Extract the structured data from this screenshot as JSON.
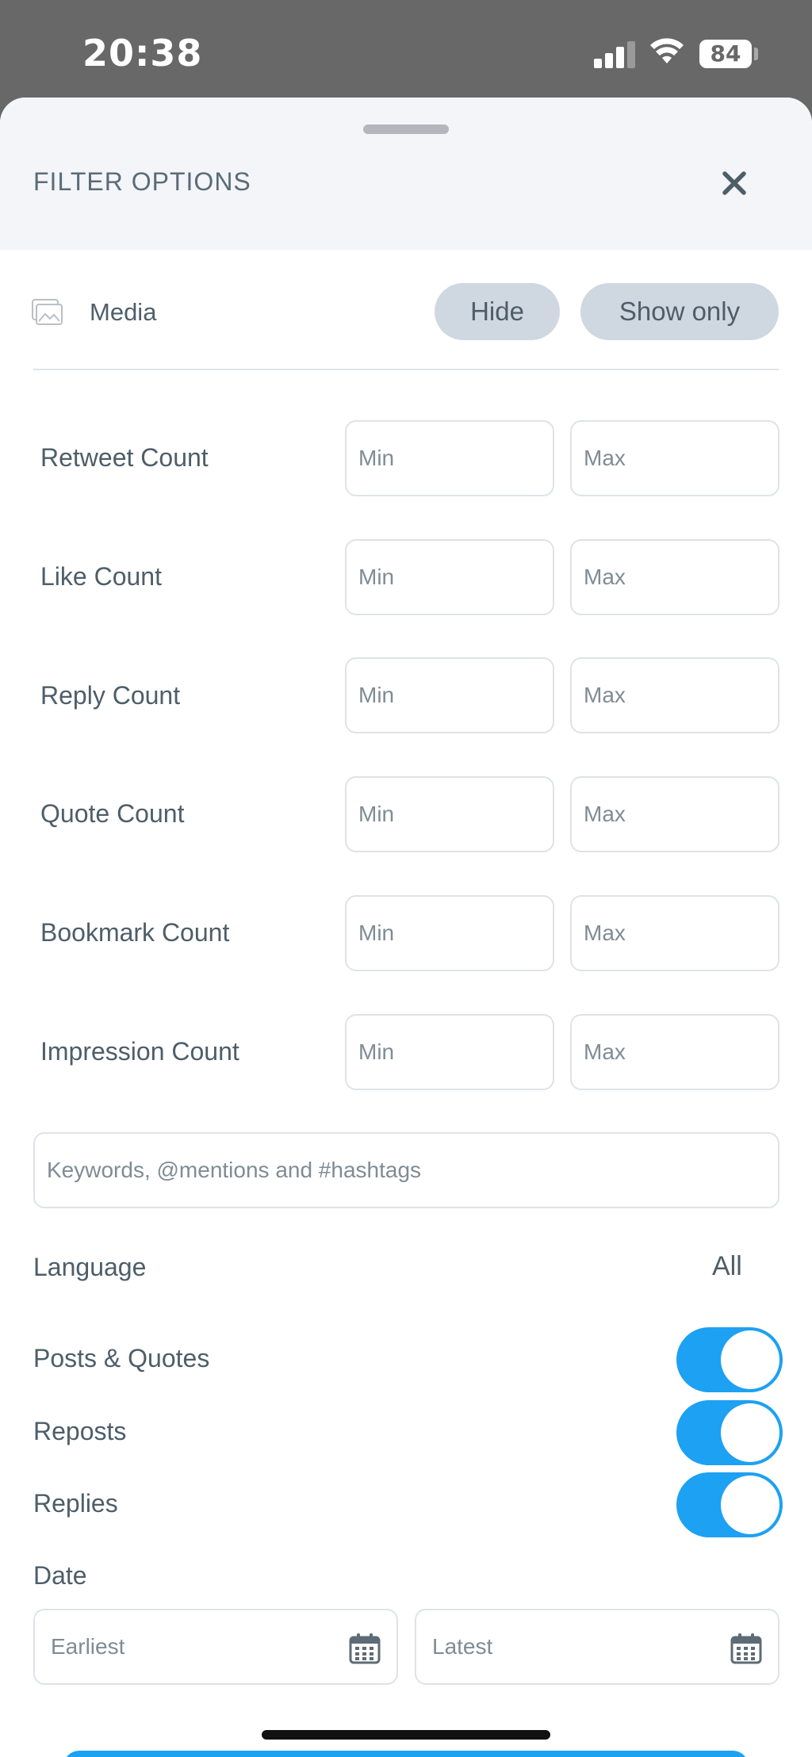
{
  "status_bar": {
    "time": "20:38",
    "battery": "84"
  },
  "header": {
    "title": "FILTER OPTIONS",
    "close_icon": "close-icon"
  },
  "media": {
    "label": "Media",
    "hide_label": "Hide",
    "show_only_label": "Show only",
    "icon": "image-icon"
  },
  "counts": [
    {
      "label": "Retweet Count",
      "min_placeholder": "Min",
      "max_placeholder": "Max"
    },
    {
      "label": "Like Count",
      "min_placeholder": "Min",
      "max_placeholder": "Max"
    },
    {
      "label": "Reply Count",
      "min_placeholder": "Min",
      "max_placeholder": "Max"
    },
    {
      "label": "Quote Count",
      "min_placeholder": "Min",
      "max_placeholder": "Max"
    },
    {
      "label": "Bookmark Count",
      "min_placeholder": "Min",
      "max_placeholder": "Max"
    },
    {
      "label": "Impression Count",
      "min_placeholder": "Min",
      "max_placeholder": "Max"
    }
  ],
  "keywords": {
    "placeholder": "Keywords, @mentions and #hashtags"
  },
  "language": {
    "label": "Language",
    "value": "All"
  },
  "toggles": [
    {
      "label": "Posts & Quotes",
      "on": true
    },
    {
      "label": "Reposts",
      "on": true
    },
    {
      "label": "Replies",
      "on": true
    }
  ],
  "date": {
    "label": "Date",
    "earliest_placeholder": "Earliest",
    "latest_placeholder": "Latest",
    "icon": "calendar-icon"
  },
  "colors": {
    "accent": "#1da1f2",
    "pill_bg": "#cfd8e0",
    "header_bg": "#f3f5f9"
  }
}
